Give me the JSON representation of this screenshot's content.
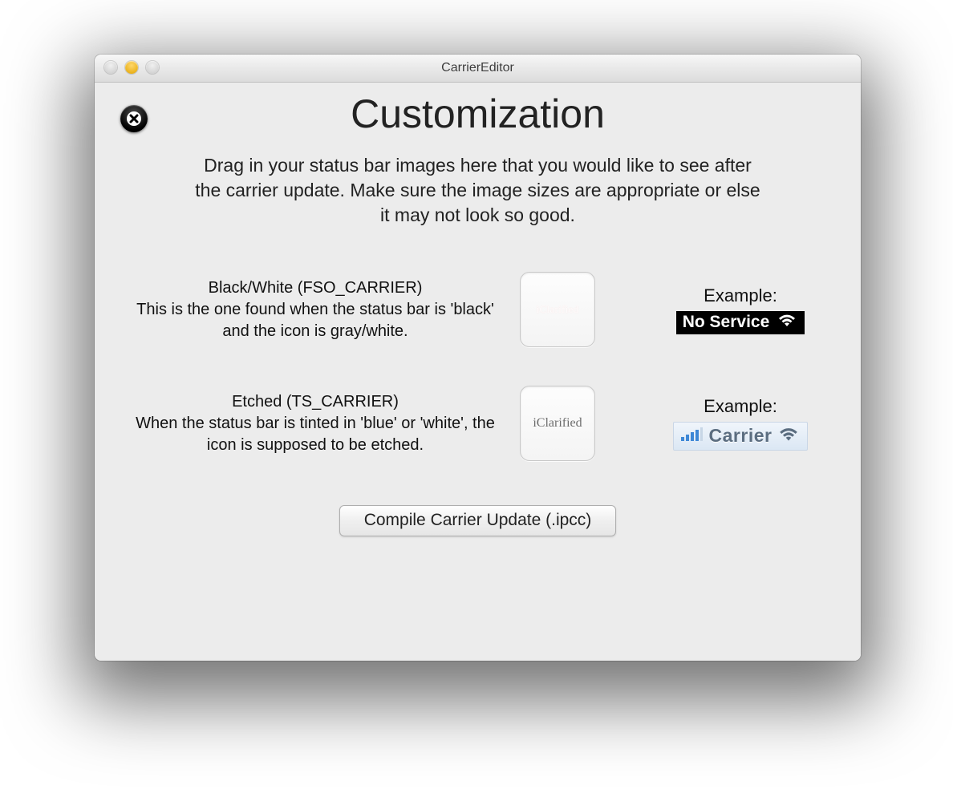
{
  "window": {
    "title": "CarrierEditor"
  },
  "page": {
    "heading": "Customization",
    "description": "Drag in your status bar images here that you would like to see after the carrier update. Make sure the image sizes are appropriate or else it may not look so good."
  },
  "rows": {
    "black_white": {
      "label": "Black/White (FSO_CARRIER)",
      "description": "This is the one found when the status bar is 'black' and the icon is gray/white.",
      "thumb_text": "iClarified",
      "example_label": "Example:",
      "example_statusbar_text": "No Service"
    },
    "etched": {
      "label": "Etched (TS_CARRIER)",
      "description": "When the status bar is tinted in 'blue' or 'white', the icon is supposed to be etched.",
      "thumb_text": "iClarified",
      "example_label": "Example:",
      "example_statusbar_text": "Carrier"
    }
  },
  "actions": {
    "compile_label": "Compile Carrier Update (.ipcc)"
  }
}
